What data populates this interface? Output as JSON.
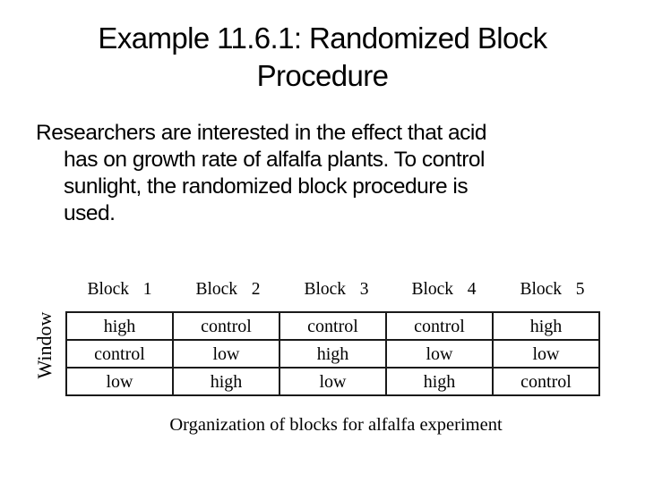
{
  "slide": {
    "title_lines": [
      "Example 11.6.1: Randomized Block",
      "Procedure"
    ],
    "body_lines": [
      "Researchers are interested in the effect that acid",
      "has on growth rate of alfalfa plants. To control",
      "sunlight, the randomized block procedure is",
      "used."
    ]
  },
  "figure": {
    "row_label": "Window",
    "block_headers": [
      "Block  1",
      "Block  2",
      "Block  3",
      "Block  4",
      "Block  5"
    ],
    "rows": [
      [
        "high",
        "control",
        "control",
        "control",
        "high"
      ],
      [
        "control",
        "low",
        "high",
        "low",
        "low"
      ],
      [
        "low",
        "high",
        "low",
        "high",
        "control"
      ]
    ],
    "caption": "Organization of blocks for alfalfa experiment"
  }
}
